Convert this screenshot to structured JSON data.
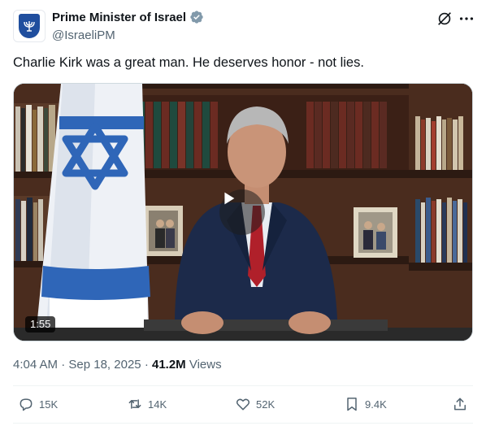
{
  "account": {
    "name": "Prime Minister of Israel",
    "handle": "@IsraeliPM",
    "avatar_icon": "menorah-emblem-icon",
    "verified_icon": "verified-badge-icon",
    "verified_color": "#829aab"
  },
  "tweet": {
    "text": "Charlie Kirk was a great man. He deserves honor - not lies."
  },
  "media": {
    "type": "video",
    "duration": "1:55",
    "play_icon": "play-icon"
  },
  "meta": {
    "time": "4:04 AM",
    "separator_1": "·",
    "date": "Sep 18, 2025",
    "separator_2": "·",
    "views_count": "41.2M",
    "views_label": "Views"
  },
  "actions": {
    "reply_count": "15K",
    "repost_count": "14K",
    "like_count": "52K",
    "bookmark_count": "9.4K"
  },
  "colors": {
    "text_primary": "#0f1419",
    "text_secondary": "#536471",
    "divider": "#eff3f4"
  }
}
